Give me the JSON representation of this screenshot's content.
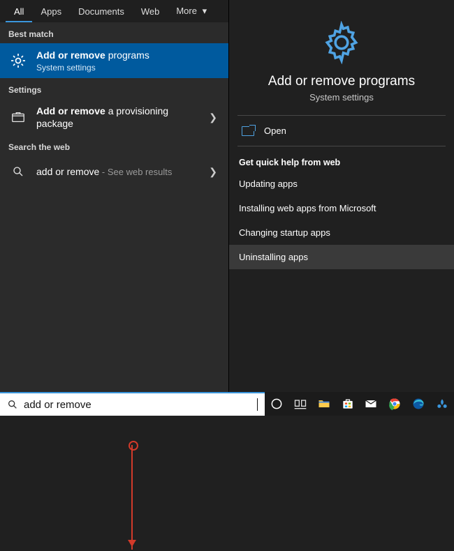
{
  "tabs": {
    "all": "All",
    "apps": "Apps",
    "documents": "Documents",
    "web": "Web",
    "more": "More"
  },
  "sections": {
    "best": "Best match",
    "settings": "Settings",
    "web": "Search the web"
  },
  "best": {
    "prefix": "Add or remove ",
    "rest": "programs",
    "sub": "System settings"
  },
  "setrow": {
    "prefix": "Add or remove ",
    "rest": "a provisioning package"
  },
  "webrow": {
    "prefix": "add or remove",
    "suffix": " - See web results"
  },
  "hero": {
    "title": "Add or remove programs",
    "sub": "System settings"
  },
  "open": {
    "label": "Open"
  },
  "help": {
    "title": "Get quick help from web",
    "items": [
      "Updating apps",
      "Installing web apps from Microsoft",
      "Changing startup apps",
      "Uninstalling apps"
    ]
  },
  "search": {
    "value": "add or remove"
  }
}
